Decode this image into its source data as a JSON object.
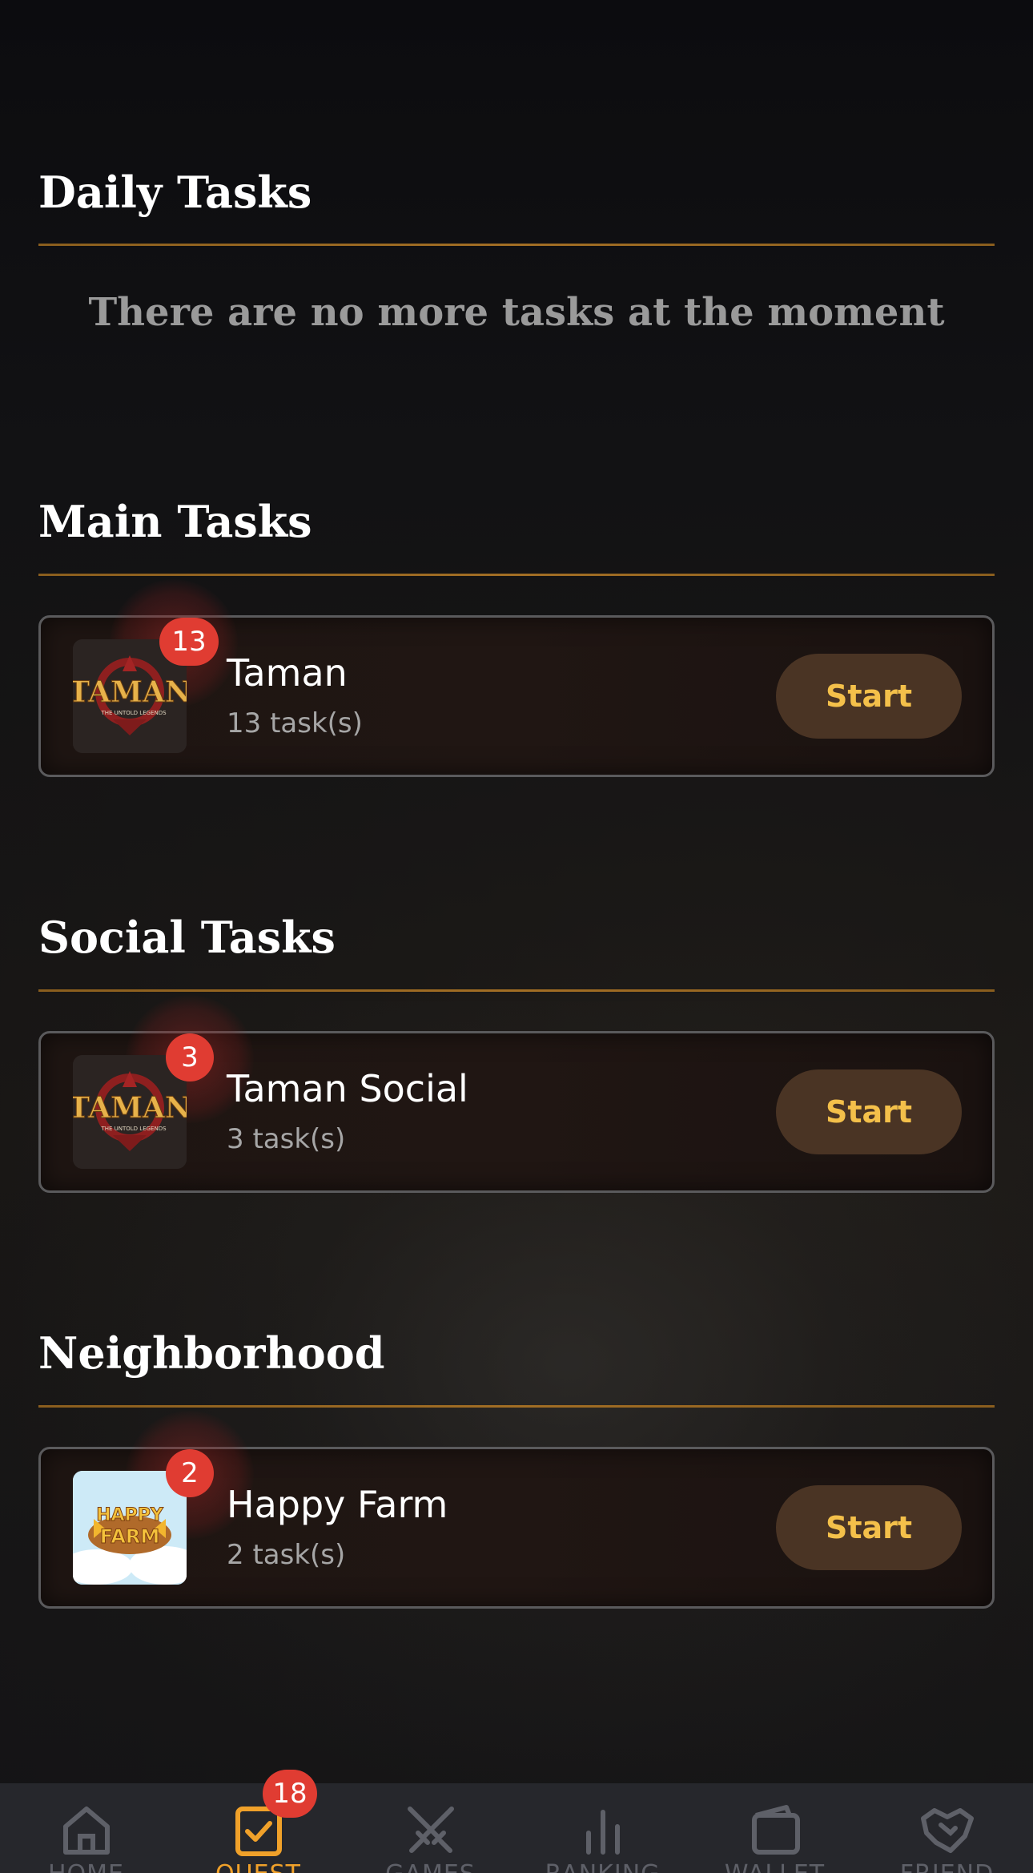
{
  "sections": {
    "daily": {
      "title": "Daily Tasks",
      "empty_message": "There are no more tasks at the moment"
    },
    "main": {
      "title": "Main Tasks",
      "task": {
        "name": "Taman",
        "count_label": "13 task(s)",
        "badge": "13",
        "button": "Start",
        "thumb_logo_text": "TAMAN",
        "thumb_logo_sub": "THE UNTOLD LEGENDS"
      }
    },
    "social": {
      "title": "Social Tasks",
      "task": {
        "name": "Taman Social",
        "count_label": "3 task(s)",
        "badge": "3",
        "button": "Start",
        "thumb_logo_text": "TAMAN",
        "thumb_logo_sub": "THE UNTOLD LEGENDS"
      }
    },
    "neighborhood": {
      "title": "Neighborhood",
      "task": {
        "name": "Happy Farm",
        "count_label": "2 task(s)",
        "badge": "2",
        "button": "Start",
        "thumb_logo_text_1": "HAPPY",
        "thumb_logo_text_2": "FARM"
      }
    }
  },
  "nav": {
    "items": [
      {
        "label": "HOME",
        "icon": "home-icon"
      },
      {
        "label": "QUEST",
        "icon": "quest-check-icon",
        "active": true
      },
      {
        "label": "GAMES",
        "icon": "crossed-swords-icon"
      },
      {
        "label": "RANKING",
        "icon": "bar-chart-icon"
      },
      {
        "label": "WALLET",
        "icon": "wallet-icon"
      },
      {
        "label": "FRIEND",
        "icon": "handshake-icon"
      }
    ],
    "quest_badge": "18"
  },
  "colors": {
    "accent": "#f0a12a",
    "button_text": "#f4c04a",
    "button_bg": "#4a3424",
    "badge": "#e03c32",
    "rule": "#a26e24"
  }
}
